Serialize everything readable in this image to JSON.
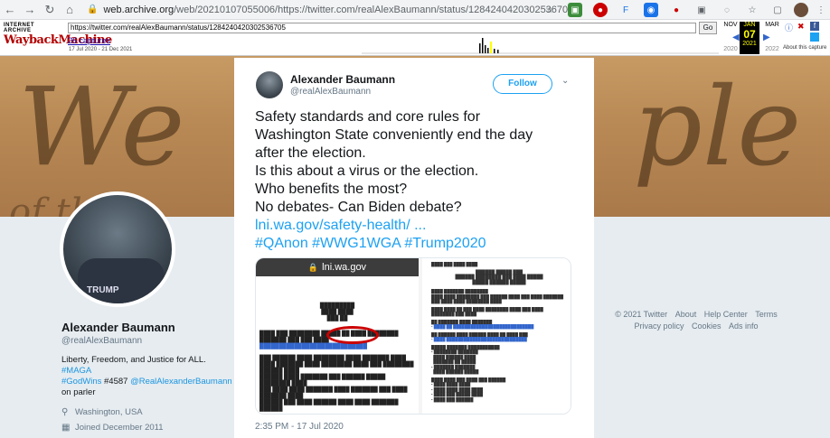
{
  "browser": {
    "url_host": "web.archive.org",
    "url_path": "/web/20210107055006/https://twitter.com/realAlexBaumann/status/1284240420302536705"
  },
  "wayback": {
    "logo_top": "INTERNET ARCHIVE",
    "logo_main": "WaybackMachine",
    "url_field": "https://twitter.com/realAlexBaumann/status/1284240420302536705",
    "go_label": "Go",
    "captures": "26 captures",
    "range": "17 Jul 2020 - 21 Dec 2021",
    "prev_month": "NOV",
    "cur_month": "JAN",
    "cur_day": "07",
    "next_month": "MAR",
    "prev_year": "2020",
    "cur_year": "2021",
    "next_year": "2022",
    "about": "About this capture"
  },
  "profile": {
    "name": "Alexander Baumann",
    "handle": "@realAlexBaumann",
    "bio_prefix": "Liberty, Freedom, and Justice for ALL.",
    "bio_tag1": "#MAGA",
    "bio_tag2": "#GodWins",
    "bio_mid": "#4587",
    "bio_mention": "@RealAlexanderBaumann",
    "bio_suffix": "on parler",
    "location": "Washington, USA",
    "joined": "Joined December 2011",
    "shirt_text": "TRUMP"
  },
  "footer": {
    "copyright": "© 2021 Twitter",
    "about": "About",
    "help": "Help Center",
    "terms": "Terms",
    "privacy": "Privacy policy",
    "cookies": "Cookies",
    "ads": "Ads info"
  },
  "tweet": {
    "name": "Alexander Baumann",
    "handle": "@realAlexBaumann",
    "follow": "Follow",
    "lines": [
      "Safety standards and core rules for",
      "Washington State conveniently end the day",
      "after the election.",
      "Is this about a virus or the election.",
      "Who benefits the most?",
      "No debates- Can Biden debate?"
    ],
    "link": "lni.wa.gov/safety-health/ ...",
    "hashtags": "#QAnon #WWG1WGA #Trump2020",
    "media_bar": "lni.wa.gov",
    "timestamp": "2:35 PM - 17 Jul 2020"
  }
}
